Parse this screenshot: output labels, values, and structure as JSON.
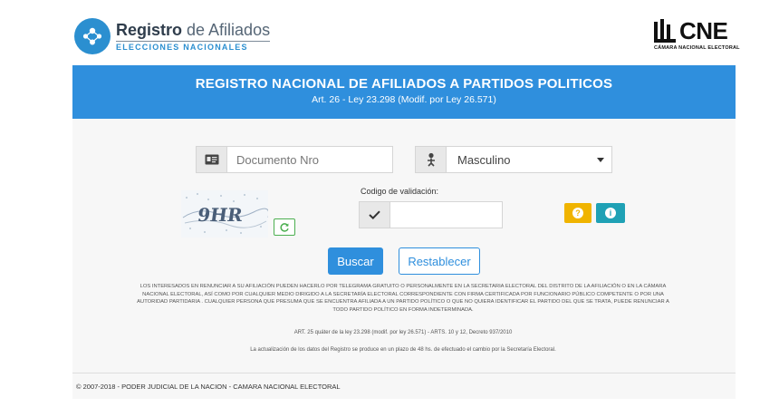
{
  "brand": {
    "title_bold": "Registro",
    "title_rest": " de Afiliados",
    "subtitle": "ELECCIONES NACIONALES"
  },
  "cne": {
    "word": "CNE",
    "subtitle": "CÁMARA NACIONAL ELECTORAL"
  },
  "banner": {
    "title": "REGISTRO NACIONAL DE AFILIADOS A PARTIDOS POLITICOS",
    "subtitle": "Art. 26 - Ley 23.298 (Modif. por Ley 26.571)"
  },
  "form": {
    "document_placeholder": "Documento Nro",
    "gender_selected": "Masculino",
    "validation_label": "Codigo de validación:",
    "validation_value": "",
    "captcha_text": "9HR",
    "help_icon": "?",
    "info_icon": "i"
  },
  "buttons": {
    "search": "Buscar",
    "reset": "Restablecer"
  },
  "legal": {
    "paragraph": "LOS INTERESADOS EN RENUNCIAR A SU AFILIACIÓN PUEDEN HACERLO POR TELEGRAMA GRATUITO O PERSONALMENTE EN LA SECRETARIA ELECTORAL DEL DISTRITO DE LA AFILIACIÓN O EN LA CÁMARA NACIONAL ELECTORAL, ASÍ COMO POR CUALQUIER MEDIO DIRIGIDO A LA SECRETARÍA ELECTORAL CORRESPONDIENTE CON FIRMA CERTIFICADA POR FUNCIONARIO PÚBLICO COMPETENTE O POR UNA AUTORIDAD PARTIDARIA . CUALQUIER PERSONA QUE PRESUMA QUE SE ENCUENTRA AFILIADA A UN PARTIDO POLÍTICO O QUE NO QUIERA IDENTIFICAR EL PARTIDO DEL QUE SE TRATA, PUEDE RENUNCIAR A TODO PARTIDO POLÍTICO EN FORMA INDETERMINADA.",
    "art_line": "ART. 25 quáter de la ley 23.298 (modif. por ley 26.571) - ARTS. 10 y 12, Decreto 937/2010",
    "update_line": "La actualización de los datos del Registro se produce en un plazo de 48 hs. de efectuado el cambio por la Secretaría Electoral."
  },
  "footer": {
    "text": "© 2007-2018 - PODER JUDICIAL DE LA NACION - CAMARA NACIONAL ELECTORAL"
  },
  "colors": {
    "primary": "#2f8fdd",
    "warning": "#f0b400",
    "info": "#1fa1b5",
    "success": "#4caf50"
  },
  "icons": {
    "logo": "people-network-icon",
    "document": "id-card-icon",
    "gender": "person-icon",
    "check": "check-icon",
    "refresh": "refresh-icon",
    "help": "question-icon",
    "info": "info-icon"
  }
}
